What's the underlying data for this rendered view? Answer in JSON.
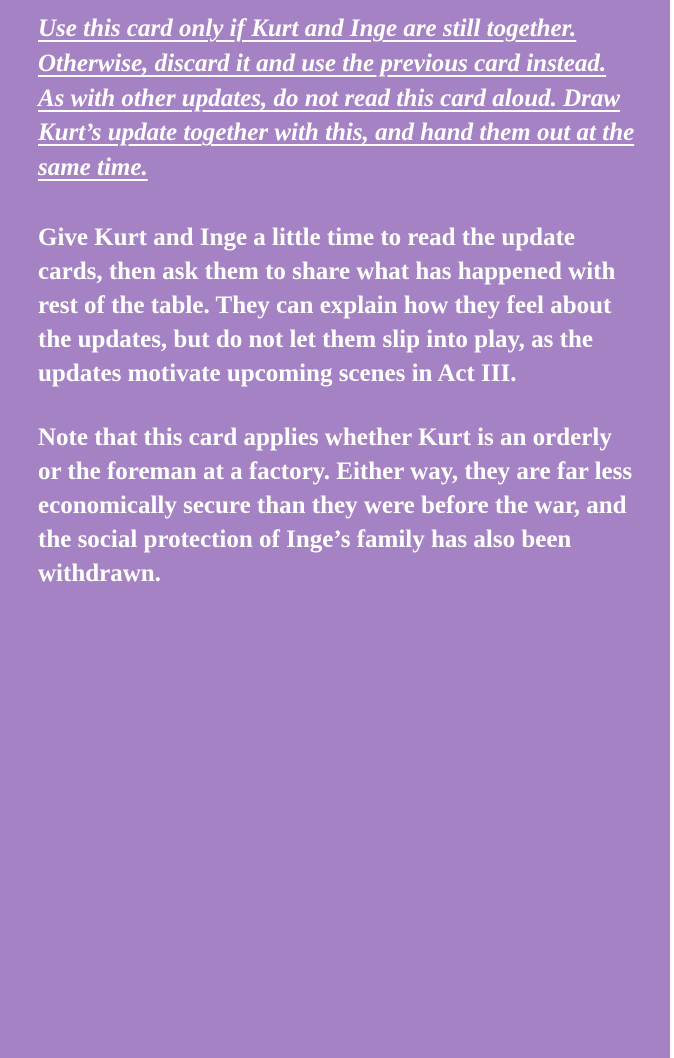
{
  "card": {
    "background_color": "#a582c3",
    "text_color": "#ffffff",
    "instruction": "Use this card only if Kurt and Inge are still together. Otherwise, discard it and use the previous card instead.  As with other updates, do not read this card aloud. Draw Kurt’s update together with this, and hand them out at the same time.",
    "paragraphs": [
      "Give Kurt and Inge a little time to read the update cards, then ask them to share what has happened with rest of the table. They can explain how they feel about  the updates, but do not let them slip into play, as the updates motivate upcoming scenes in Act III.",
      "Note that this card applies whether Kurt is an orderly or the foreman at a factory. Either way, they are far less economically secure than they were before the war, and the social protection of Inge’s family has also been withdrawn."
    ]
  }
}
